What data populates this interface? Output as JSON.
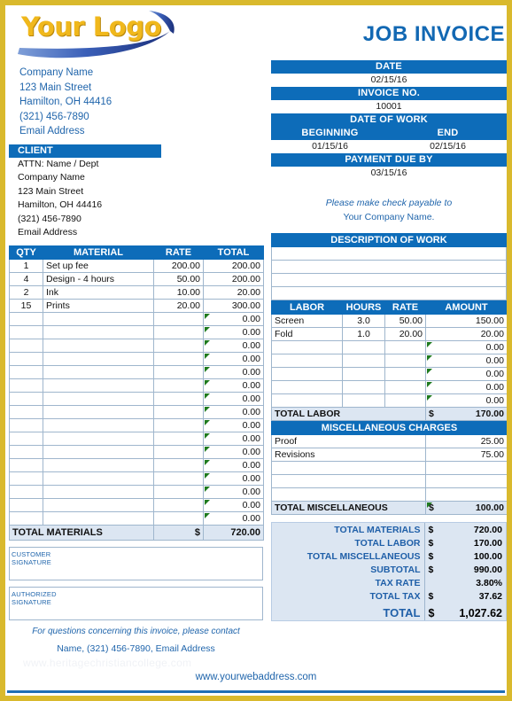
{
  "colors": {
    "accent_blue": "#0d6cb9",
    "border_gold": "#d9b92d",
    "logo_gold": "#f0b81c",
    "summary_bg": "#dce6f2",
    "text_blue": "#2166ac",
    "flag_green": "#1e7a1e"
  },
  "logo": {
    "text": "Your Logo"
  },
  "company": {
    "lines": [
      "Company Name",
      "123 Main Street",
      "Hamilton, OH  44416",
      "(321) 456-7890",
      "Email Address"
    ]
  },
  "client": {
    "header": "CLIENT",
    "lines": [
      "ATTN: Name / Dept",
      "Company Name",
      "123 Main Street",
      "Hamilton, OH  44416",
      "(321) 456-7890",
      "Email Address"
    ]
  },
  "title": "JOB INVOICE",
  "invoice_meta": {
    "date_label": "DATE",
    "date_value": "02/15/16",
    "invoice_no_label": "INVOICE NO.",
    "invoice_no_value": "10001",
    "date_of_work_label": "DATE OF WORK",
    "beginning_label": "BEGINNING",
    "end_label": "END",
    "beginning_value": "01/15/16",
    "end_value": "02/15/16",
    "payment_due_label": "PAYMENT DUE BY",
    "payment_due_value": "03/15/16"
  },
  "payable": {
    "line1": "Please make check payable to",
    "line2": "Your Company Name."
  },
  "materials": {
    "headers": [
      "QTY",
      "MATERIAL",
      "RATE",
      "TOTAL"
    ],
    "rows": [
      {
        "qty": "1",
        "material": "Set up fee",
        "rate": "200.00",
        "total": "200.00",
        "flag": false
      },
      {
        "qty": "4",
        "material": "Design - 4 hours",
        "rate": "50.00",
        "total": "200.00",
        "flag": false
      },
      {
        "qty": "2",
        "material": "Ink",
        "rate": "10.00",
        "total": "20.00",
        "flag": false
      },
      {
        "qty": "15",
        "material": "Prints",
        "rate": "20.00",
        "total": "300.00",
        "flag": false
      },
      {
        "qty": "",
        "material": "",
        "rate": "",
        "total": "0.00",
        "flag": true
      },
      {
        "qty": "",
        "material": "",
        "rate": "",
        "total": "0.00",
        "flag": true
      },
      {
        "qty": "",
        "material": "",
        "rate": "",
        "total": "0.00",
        "flag": true
      },
      {
        "qty": "",
        "material": "",
        "rate": "",
        "total": "0.00",
        "flag": true
      },
      {
        "qty": "",
        "material": "",
        "rate": "",
        "total": "0.00",
        "flag": true
      },
      {
        "qty": "",
        "material": "",
        "rate": "",
        "total": "0.00",
        "flag": true
      },
      {
        "qty": "",
        "material": "",
        "rate": "",
        "total": "0.00",
        "flag": true
      },
      {
        "qty": "",
        "material": "",
        "rate": "",
        "total": "0.00",
        "flag": true
      },
      {
        "qty": "",
        "material": "",
        "rate": "",
        "total": "0.00",
        "flag": true
      },
      {
        "qty": "",
        "material": "",
        "rate": "",
        "total": "0.00",
        "flag": true
      },
      {
        "qty": "",
        "material": "",
        "rate": "",
        "total": "0.00",
        "flag": true
      },
      {
        "qty": "",
        "material": "",
        "rate": "",
        "total": "0.00",
        "flag": true
      },
      {
        "qty": "",
        "material": "",
        "rate": "",
        "total": "0.00",
        "flag": true
      },
      {
        "qty": "",
        "material": "",
        "rate": "",
        "total": "0.00",
        "flag": true
      },
      {
        "qty": "",
        "material": "",
        "rate": "",
        "total": "0.00",
        "flag": true
      },
      {
        "qty": "",
        "material": "",
        "rate": "",
        "total": "0.00",
        "flag": true
      }
    ],
    "total_label": "TOTAL MATERIALS",
    "total_currency": "$",
    "total_value": "720.00"
  },
  "signatures": {
    "customer_line1": "CUSTOMER",
    "customer_line2": "SIGNATURE",
    "authorized_line1": "AUTHORIZED",
    "authorized_line2": "SIGNATURE"
  },
  "contact": {
    "line1": "For questions concerning this invoice, please contact",
    "line2": "Name, (321) 456-7890, Email Address"
  },
  "description_of_work": {
    "header": "DESCRIPTION OF WORK",
    "rows": [
      "",
      "",
      "",
      ""
    ]
  },
  "labor": {
    "headers": [
      "LABOR",
      "HOURS",
      "RATE",
      "AMOUNT"
    ],
    "rows": [
      {
        "labor": "Screen",
        "hours": "3.0",
        "rate": "50.00",
        "amount": "150.00",
        "flag": false
      },
      {
        "labor": "Fold",
        "hours": "1.0",
        "rate": "20.00",
        "amount": "20.00",
        "flag": false
      },
      {
        "labor": "",
        "hours": "",
        "rate": "",
        "amount": "0.00",
        "flag": true
      },
      {
        "labor": "",
        "hours": "",
        "rate": "",
        "amount": "0.00",
        "flag": true
      },
      {
        "labor": "",
        "hours": "",
        "rate": "",
        "amount": "0.00",
        "flag": true
      },
      {
        "labor": "",
        "hours": "",
        "rate": "",
        "amount": "0.00",
        "flag": true
      },
      {
        "labor": "",
        "hours": "",
        "rate": "",
        "amount": "0.00",
        "flag": true
      }
    ],
    "total_label": "TOTAL LABOR",
    "total_currency": "$",
    "total_value": "170.00"
  },
  "misc": {
    "header": "MISCELLANEOUS CHARGES",
    "rows": [
      {
        "desc": "Proof",
        "amount": "25.00"
      },
      {
        "desc": "Revisions",
        "amount": "75.00"
      },
      {
        "desc": "",
        "amount": ""
      },
      {
        "desc": "",
        "amount": ""
      },
      {
        "desc": "",
        "amount": ""
      }
    ],
    "total_label": "TOTAL MISCELLANEOUS",
    "total_currency": "$",
    "total_value": "100.00"
  },
  "summary": {
    "rows": [
      {
        "label": "TOTAL MATERIALS",
        "currency": "$",
        "value": "720.00"
      },
      {
        "label": "TOTAL LABOR",
        "currency": "$",
        "value": "170.00"
      },
      {
        "label": "TOTAL MISCELLANEOUS",
        "currency": "$",
        "value": "100.00"
      },
      {
        "label": "SUBTOTAL",
        "currency": "$",
        "value": "990.00"
      },
      {
        "label": "TAX RATE",
        "currency": "",
        "value": "3.80%"
      },
      {
        "label": "TOTAL TAX",
        "currency": "$",
        "value": "37.62"
      }
    ],
    "grand": {
      "label": "TOTAL",
      "currency": "$",
      "value": "1,027.62"
    }
  },
  "footer": {
    "web_address": "www.yourwebaddress.com",
    "watermark": "www.heritagechristiancollege.com"
  }
}
